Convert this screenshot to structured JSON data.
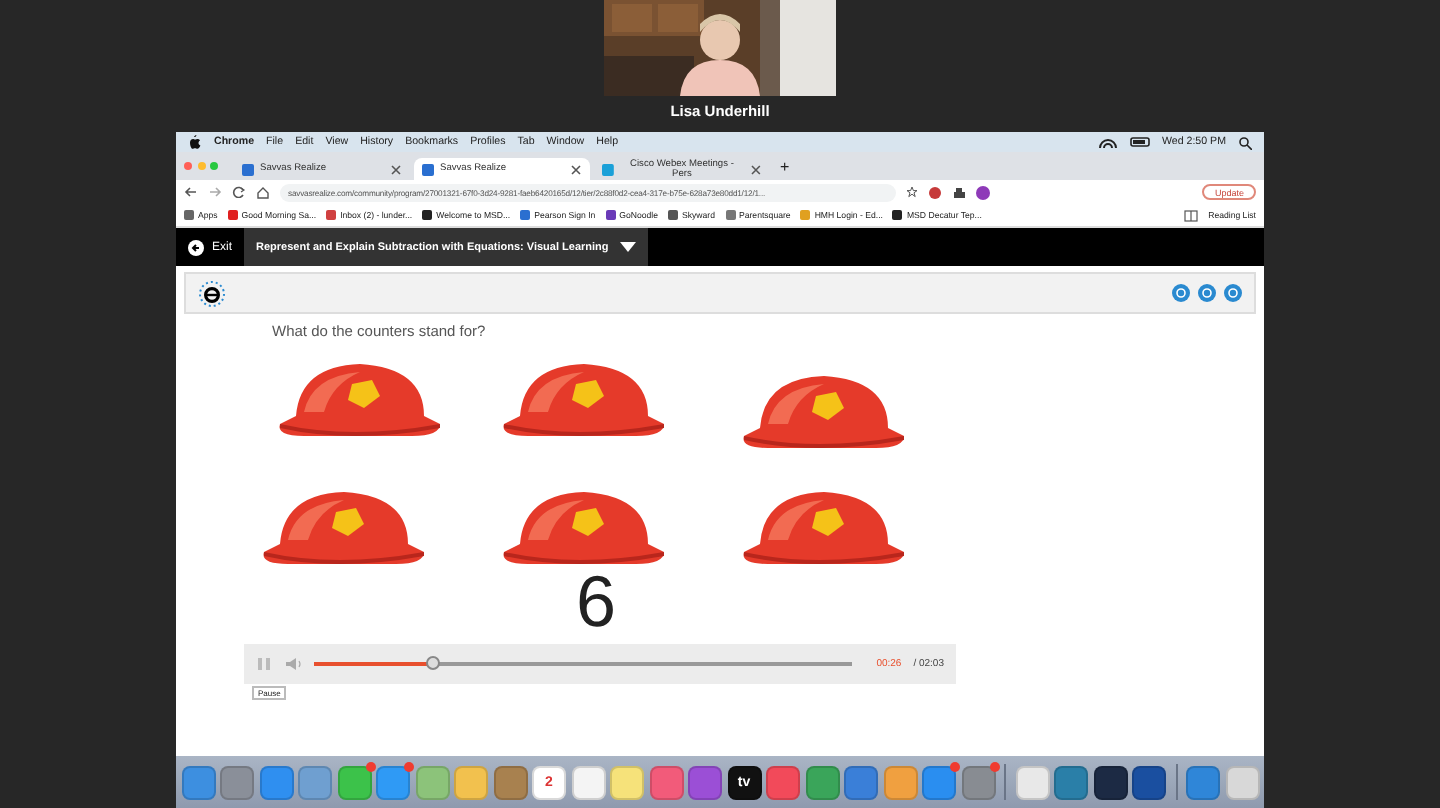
{
  "meeting": {
    "participant_name": "Lisa Underhill"
  },
  "menu_bar": {
    "items": [
      "Chrome",
      "File",
      "Edit",
      "View",
      "History",
      "Bookmarks",
      "Profiles",
      "Tab",
      "Window",
      "Help"
    ],
    "clock": "Wed 2:50 PM"
  },
  "browser": {
    "tabs": [
      {
        "label": "Savvas Realize",
        "selected": false
      },
      {
        "label": "Savvas Realize",
        "selected": true
      },
      {
        "label": "Cisco Webex Meetings - Pers",
        "selected": false
      }
    ],
    "new_tab": "+",
    "address": "savvasrealize.com/community/program/27001321-67f0-3d24-9281-faeb6420165d/12/tier/2c88f0d2-cea4-317e-b75e-628a73e80dd1/12/1...",
    "update_button": "Update",
    "bookmarks": [
      "Apps",
      "Good Morning Sa...",
      "Inbox (2) - lunder...",
      "Welcome to MSD...",
      "Pearson Sign In",
      "GoNoodle",
      "Skyward",
      "Parentsquare",
      "HMH Login - Ed...",
      "MSD Decatur Tep..."
    ],
    "reading_list": "Reading List"
  },
  "lesson": {
    "exit": "Exit",
    "title": "Represent and Explain Subtraction with Equations: Visual Learning",
    "question": "What do the counters stand for?",
    "answer": "6",
    "counters": [
      {
        "kind": "helmet"
      },
      {
        "kind": "helmet"
      },
      {
        "kind": "helmet"
      },
      {
        "kind": "helmet"
      },
      {
        "kind": "helmet"
      },
      {
        "kind": "helmet"
      }
    ]
  },
  "player": {
    "level": 0.22,
    "elapsed": "00:26",
    "total": "/ 02:03",
    "tooltip": "Pause"
  },
  "dock": [
    {
      "kind": "app",
      "color": "#3d8fe0",
      "badge": false
    },
    {
      "kind": "app",
      "color": "#8a8f99",
      "badge": false
    },
    {
      "kind": "app",
      "color": "#2f8ff0",
      "badge": false
    },
    {
      "kind": "app",
      "color": "#6f9fd0",
      "badge": false
    },
    {
      "kind": "app",
      "color": "#3cc24a",
      "badge": true
    },
    {
      "kind": "app",
      "color": "#2f9af5",
      "badge": true
    },
    {
      "kind": "app",
      "color": "#8cc37a",
      "badge": false
    },
    {
      "kind": "app",
      "color": "#f2c14e",
      "badge": false
    },
    {
      "kind": "app",
      "color": "#a8814f",
      "badge": false
    },
    {
      "kind": "app",
      "color": "#ffffff",
      "badge": false,
      "label": "2"
    },
    {
      "kind": "app",
      "color": "#f4f4f4",
      "badge": false
    },
    {
      "kind": "app",
      "color": "#f6e27a",
      "badge": false
    },
    {
      "kind": "app",
      "color": "#f25b7a",
      "badge": false
    },
    {
      "kind": "app",
      "color": "#9b4fd6",
      "badge": false
    },
    {
      "kind": "app",
      "color": "#111111",
      "badge": false,
      "label": "tv"
    },
    {
      "kind": "app",
      "color": "#f24a5a",
      "badge": false
    },
    {
      "kind": "app",
      "color": "#3aa55a",
      "badge": false
    },
    {
      "kind": "app",
      "color": "#3a7fd8",
      "badge": false
    },
    {
      "kind": "app",
      "color": "#f0a040",
      "badge": false
    },
    {
      "kind": "app",
      "color": "#2a8ef0",
      "badge": true
    },
    {
      "kind": "app",
      "color": "#888c92",
      "badge": true
    },
    {
      "kind": "separator"
    },
    {
      "kind": "app",
      "color": "#e8e8e8",
      "badge": false
    },
    {
      "kind": "app",
      "color": "#2a7fa8",
      "badge": false
    },
    {
      "kind": "app",
      "color": "#1c2a44",
      "badge": false
    },
    {
      "kind": "app",
      "color": "#1a4fa0",
      "badge": false
    },
    {
      "kind": "separator"
    },
    {
      "kind": "app",
      "color": "#2f86d8",
      "badge": false
    },
    {
      "kind": "app",
      "color": "#d8d8d8",
      "badge": false
    }
  ]
}
